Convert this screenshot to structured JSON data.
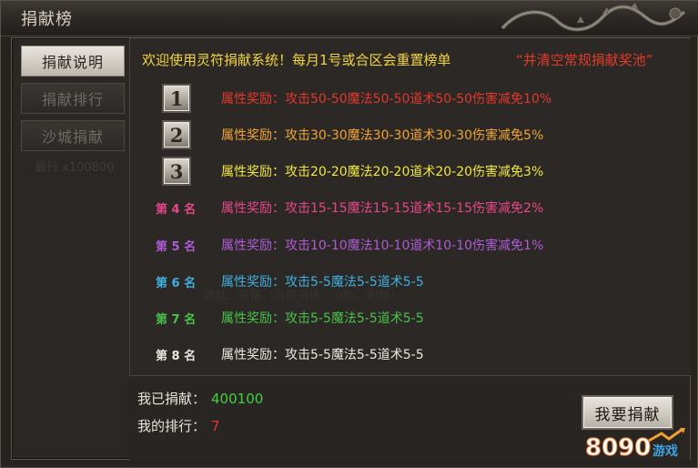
{
  "window": {
    "title": "捐献榜"
  },
  "sidebar": {
    "items": [
      {
        "label": "捐献说明",
        "active": true
      },
      {
        "label": "捐献排行",
        "active": false
      },
      {
        "label": "沙城捐献",
        "active": false
      }
    ],
    "faint_text": "最行 x100800"
  },
  "main": {
    "welcome": "欢迎使用灵符捐献系统！每月1号或合区会重置榜单",
    "pool_note": "“并清空常规捐献奖池”",
    "ghost_text": "捐献...资格，当前资格 ...0%，刷新！",
    "ranks": [
      {
        "badge": "1",
        "label": "",
        "reward": "属性奖励：攻击50-50魔法50-50道术50-50伤害减免10%",
        "color": "#e3382b"
      },
      {
        "badge": "2",
        "label": "",
        "reward": "属性奖励：攻击30-30魔法30-30道术30-30伤害减免5%",
        "color": "#f0a436"
      },
      {
        "badge": "3",
        "label": "",
        "reward": "属性奖励：攻击20-20魔法20-20道术20-20伤害减免3%",
        "color": "#f2e640"
      },
      {
        "badge": "",
        "label": "第 4 名",
        "reward": "属性奖励：攻击15-15魔法15-15道术15-15伤害减免2%",
        "color": "#e8468a"
      },
      {
        "badge": "",
        "label": "第 5 名",
        "reward": "属性奖励：攻击10-10魔法10-10道术10-10伤害减免1%",
        "color": "#b05ad6"
      },
      {
        "badge": "",
        "label": "第 6 名",
        "reward": "属性奖励：攻击5-5魔法5-5道术5-5",
        "color": "#3fb0e0"
      },
      {
        "badge": "",
        "label": "第 7 名",
        "reward": "属性奖励：攻击5-5魔法5-5道术5-5",
        "color": "#48c24a"
      },
      {
        "badge": "",
        "label": "第 8 名",
        "reward": "属性奖励：攻击5-5魔法5-5道术5-5",
        "color": "#ece7de"
      }
    ]
  },
  "footer": {
    "donated_label": "我已捐献：",
    "donated_value": "400100",
    "donated_color": "#3fd23f",
    "rank_label": "我的排行：",
    "rank_value": "7",
    "rank_color": "#e3382b",
    "donate_button": "我要捐献"
  },
  "watermark": {
    "brand": "8090",
    "tag": "游戏"
  }
}
